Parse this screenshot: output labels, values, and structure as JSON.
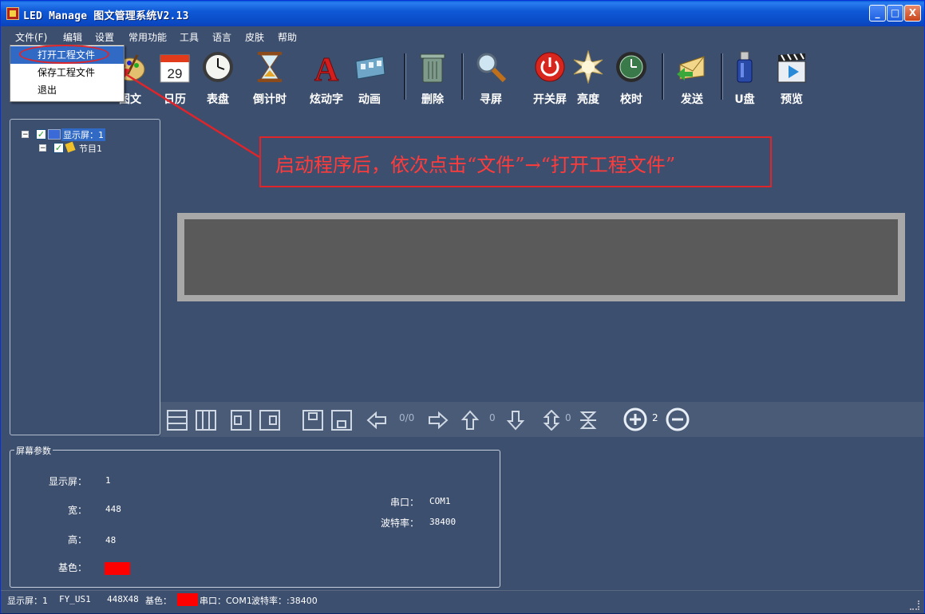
{
  "window": {
    "title": "LED Manage 图文管理系统V2.13",
    "controls": {
      "minimize": "_",
      "maximize": "□",
      "close": "X"
    }
  },
  "menu": [
    {
      "label": "文件(F)"
    },
    {
      "label": "编辑"
    },
    {
      "label": "设置"
    },
    {
      "label": "常用功能"
    },
    {
      "label": "工具"
    },
    {
      "label": "语言"
    },
    {
      "label": "皮肤"
    },
    {
      "label": "帮助"
    }
  ],
  "file_menu": {
    "items": [
      {
        "label": "打开工程文件",
        "selected": true
      },
      {
        "label": "保存工程文件",
        "selected": false
      },
      {
        "label": "退出",
        "selected": false
      }
    ]
  },
  "toolbar": {
    "items": [
      {
        "label": "图文",
        "icon": "palette-icon"
      },
      {
        "label": "日历",
        "icon": "calendar-icon",
        "icon_day": "29"
      },
      {
        "label": "表盘",
        "icon": "clock-icon"
      },
      {
        "label": "倒计时",
        "icon": "hourglass-icon"
      },
      {
        "label": "炫动字",
        "icon": "letter-a-icon",
        "icon_glyph": "A"
      },
      {
        "label": "动画",
        "icon": "film-icon"
      },
      {
        "label": "删除",
        "icon": "trash-icon"
      },
      {
        "label": "寻屏",
        "icon": "magnifier-icon"
      },
      {
        "label": "开关屏",
        "icon": "power-icon"
      },
      {
        "label": "亮度",
        "icon": "sun-icon"
      },
      {
        "label": "校时",
        "icon": "sync-clock-icon"
      },
      {
        "label": "发送",
        "icon": "send-mail-icon"
      },
      {
        "label": "U盘",
        "icon": "usb-drive-icon"
      },
      {
        "label": "预览",
        "icon": "clapperboard-icon"
      }
    ]
  },
  "tree": {
    "root": {
      "label": "显示屏：1",
      "checked": true
    },
    "child": {
      "label": "节目1",
      "checked": true
    }
  },
  "editor_toolbar": {
    "page_counter": "0/0",
    "move_value": "0",
    "move_value_2": "0",
    "zoom_value": "2"
  },
  "screen_params": {
    "title": "屏幕参数",
    "display_label": "显示屏：",
    "display_value": "1",
    "width_label": "宽：",
    "width_value": "448",
    "height_label": "高：",
    "height_value": "48",
    "base_color_label": "基色：",
    "base_color": "#ff0000",
    "port_label": "串口：",
    "port_value": "COM1",
    "baud_label": "波特率：",
    "baud_value": "38400"
  },
  "statusbar": {
    "display": "显示屏：1",
    "model": "FY_US1",
    "size": "448X48",
    "base_color_label": "基色：",
    "port": "串口：COM1",
    "baud": "波特率：:38400"
  },
  "annotation": {
    "text": "启动程序后，依次点击“文件”→“打开工程文件”",
    "color": "#e0252a"
  }
}
